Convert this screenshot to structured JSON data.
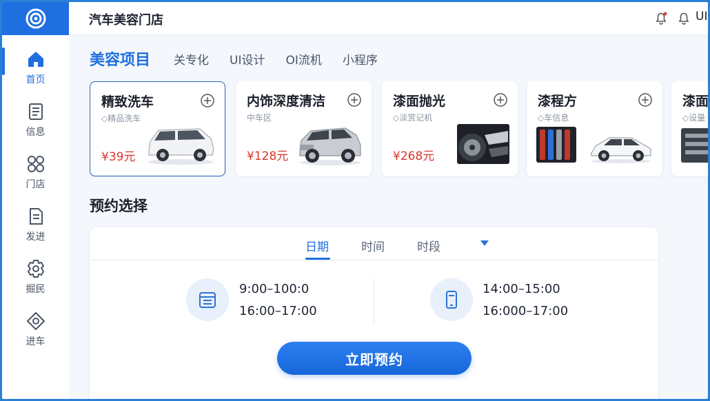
{
  "app": {
    "title": "汽车美容门店",
    "user": "UI"
  },
  "sidebar": {
    "items": [
      {
        "label": "首页",
        "icon": "home-icon",
        "active": true
      },
      {
        "label": "信息",
        "icon": "document-icon"
      },
      {
        "label": "门店",
        "icon": "grid-circles-icon"
      },
      {
        "label": "发进",
        "icon": "file-icon"
      },
      {
        "label": "掘民",
        "icon": "gear-icon"
      },
      {
        "label": "进车",
        "icon": "diamond-icon"
      }
    ]
  },
  "tabs": {
    "main": "美容项目",
    "items": [
      "关专化",
      "UI设计",
      "OI流机",
      "小程序"
    ]
  },
  "cards": [
    {
      "title": "精致洗车",
      "sub": "◇精品洗车",
      "price": "¥39元",
      "image": "minivan"
    },
    {
      "title": "内饰深度清洁",
      "sub": "中车区",
      "price": "¥128元",
      "image": "suv"
    },
    {
      "title": "漆面抛光",
      "sub": "◇淡赏记机",
      "price": "¥268元",
      "image": "wheel"
    },
    {
      "title": "漆程方",
      "sub": "◇车信息",
      "price": "",
      "image": "sedan"
    },
    {
      "title": "漆面抛",
      "sub": "◇设量",
      "price": "",
      "image": "detail"
    }
  ],
  "booking": {
    "title": "预约选择",
    "tabs": [
      "日期",
      "时间",
      "时段"
    ],
    "active_tab": "日期",
    "slots_left": [
      "9:00–100:0",
      "16:00–17:00"
    ],
    "slots_right": [
      "14:00–15:00",
      "16:000–17:00"
    ],
    "button": "立即预约"
  },
  "colors": {
    "accent": "#1f6fe0",
    "price": "#d9362b",
    "frame": "#2a7fd6"
  }
}
